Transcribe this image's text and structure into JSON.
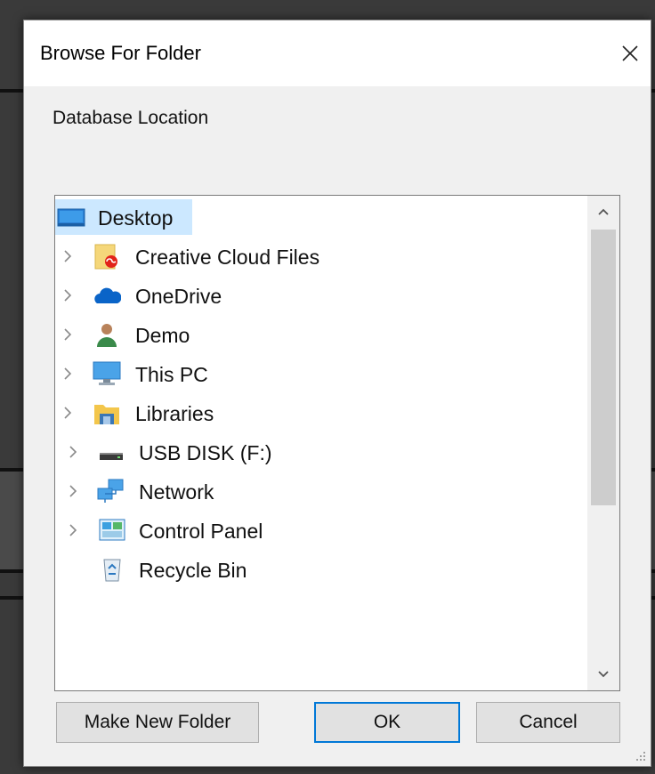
{
  "dialog": {
    "title": "Browse For Folder",
    "prompt": "Database Location"
  },
  "tree": {
    "items": [
      {
        "label": "Desktop",
        "icon": "desktop-icon",
        "expandable": false,
        "selected": true
      },
      {
        "label": "Creative Cloud Files",
        "icon": "creative-cloud-folder-icon",
        "expandable": true
      },
      {
        "label": "OneDrive",
        "icon": "onedrive-cloud-icon",
        "expandable": true
      },
      {
        "label": "Demo",
        "icon": "user-icon",
        "expandable": true
      },
      {
        "label": "This PC",
        "icon": "computer-icon",
        "expandable": true
      },
      {
        "label": "Libraries",
        "icon": "libraries-icon",
        "expandable": true
      },
      {
        "label": "USB DISK (F:)",
        "icon": "usb-drive-icon",
        "expandable": true
      },
      {
        "label": "Network",
        "icon": "network-icon",
        "expandable": true
      },
      {
        "label": "Control Panel",
        "icon": "control-panel-icon",
        "expandable": true
      },
      {
        "label": "Recycle Bin",
        "icon": "recycle-bin-icon",
        "expandable": false
      }
    ]
  },
  "buttons": {
    "make_new_folder": "Make New Folder",
    "ok": "OK",
    "cancel": "Cancel"
  },
  "colors": {
    "selection": "#cce8ff",
    "default_button_border": "#0078d7",
    "dialog_bg": "#f0f0f0"
  }
}
